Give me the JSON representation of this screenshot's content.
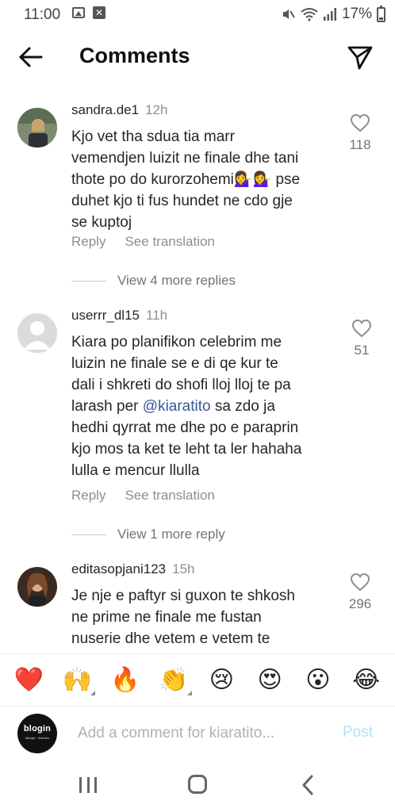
{
  "status_bar": {
    "time": "11:00",
    "battery": "17%"
  },
  "header": {
    "title": "Comments"
  },
  "comments": [
    {
      "username": "sandra.de1",
      "time": "12h",
      "lines": [
        "Kjo vet tha sdua tia marr",
        "vemendjen luizit ne finale dhe tani",
        "thote po do kurorzohemi💁‍♀️💁‍♀️ pse",
        "duhet kjo ti fus hundet ne cdo gje",
        "se kuptoj"
      ],
      "likes": "118",
      "reply_label": "Reply",
      "translate_label": "See translation",
      "view_more": "View 4 more replies"
    },
    {
      "username": "userrr_dl15",
      "time": "11h",
      "lines": [
        "Kiara po planifikon celebrim me",
        "luizin ne finale se e di qe kur te",
        "dali i shkreti do shofi lloj lloj te pa",
        "larash per",
        "hedhi qyrrat me dhe po e paraprin",
        "kjo mos ta ket te leht ta ler hahaha",
        "lulla e mencur llulla"
      ],
      "mention": "@kiaratito",
      "line4_rest": "sa zdo ja",
      "likes": "51",
      "reply_label": "Reply",
      "translate_label": "See translation",
      "view_more": "View 1 more reply"
    },
    {
      "username": "editasopjani123",
      "time": "15h",
      "lines": [
        "Je nje e paftyr si guxon te shkosh",
        "ne prime ne finale me fustan",
        "nuserie dhe vetem e vetem te"
      ],
      "likes": "296"
    }
  ],
  "emoji_bar": [
    "❤️",
    "🙌",
    "🔥",
    "👏",
    "😢",
    "😍",
    "😮",
    "😂"
  ],
  "comment_box": {
    "avatar_text": "blogin",
    "avatar_subtext": "#blogin · #stories",
    "placeholder": "Add a comment for kiaratito...",
    "post_label": "Post"
  },
  "icons": {
    "back": "arrow-left-icon",
    "send": "paper-plane-icon",
    "like": "heart-outline-icon"
  },
  "colors": {
    "mention": "#385898",
    "post_disabled": "#b2dffc",
    "secondary_text": "#8e8e8e"
  }
}
